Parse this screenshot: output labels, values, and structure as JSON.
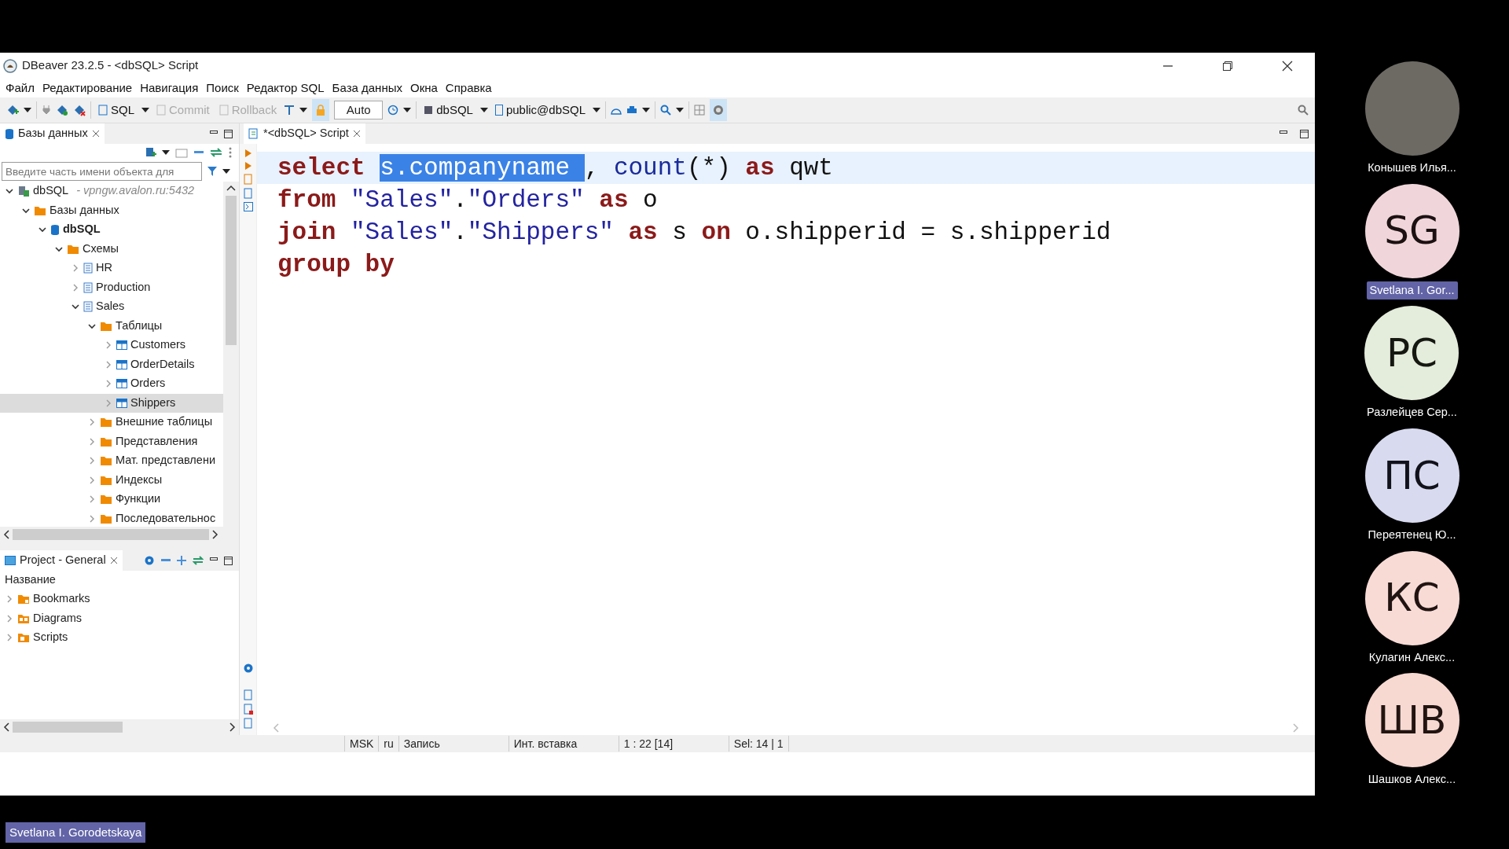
{
  "window": {
    "title": "DBeaver 23.2.5 - <dbSQL> Script"
  },
  "menu": [
    "Файл",
    "Редактирование",
    "Навигация",
    "Поиск",
    "Редактор SQL",
    "База данных",
    "Окна",
    "Справка"
  ],
  "toolbar": [
    {
      "label": "SQL",
      "disabled": false
    },
    {
      "label": "Commit",
      "disabled": true
    },
    {
      "label": "Rollback",
      "disabled": true
    },
    {
      "label": "Auto",
      "disabled": false
    },
    {
      "label": "dbSQL",
      "disabled": false
    },
    {
      "label": "public@dbSQL",
      "disabled": false
    }
  ],
  "navigator": {
    "tab": "Базы данных",
    "filter_placeholder": "Введите часть имени объекта для",
    "tree": [
      {
        "kind": "connection",
        "label": "dbSQL",
        "host": "- vpngw.avalon.ru:5432",
        "expanded": true,
        "selected": false,
        "children": [
          {
            "kind": "folder",
            "label": "Базы данных",
            "expanded": true,
            "selected": false,
            "children": [
              {
                "kind": "database",
                "label": "dbSQL",
                "expanded": true,
                "selected": false,
                "children": [
                  {
                    "kind": "folder",
                    "label": "Схемы",
                    "expanded": true,
                    "selected": false,
                    "children": [
                      {
                        "kind": "schema",
                        "label": "HR",
                        "expanded": false,
                        "selected": false
                      },
                      {
                        "kind": "schema",
                        "label": "Production",
                        "expanded": false,
                        "selected": false
                      },
                      {
                        "kind": "schema",
                        "label": "Sales",
                        "expanded": true,
                        "selected": false,
                        "children": [
                          {
                            "kind": "folder",
                            "label": "Таблицы",
                            "expanded": true,
                            "selected": false,
                            "children": [
                              {
                                "kind": "table",
                                "label": "Customers",
                                "expanded": false,
                                "selected": false
                              },
                              {
                                "kind": "table",
                                "label": "OrderDetails",
                                "expanded": false,
                                "selected": false
                              },
                              {
                                "kind": "table",
                                "label": "Orders",
                                "expanded": false,
                                "selected": false
                              },
                              {
                                "kind": "table",
                                "label": "Shippers",
                                "expanded": false,
                                "selected": true
                              }
                            ]
                          },
                          {
                            "kind": "folder",
                            "label": "Внешние таблицы",
                            "expanded": false,
                            "selected": false
                          },
                          {
                            "kind": "folder",
                            "label": "Представления",
                            "expanded": false,
                            "selected": false
                          },
                          {
                            "kind": "folder",
                            "label": "Мат. представлени",
                            "expanded": false,
                            "selected": false
                          },
                          {
                            "kind": "folder",
                            "label": "Индексы",
                            "expanded": false,
                            "selected": false
                          },
                          {
                            "kind": "folder",
                            "label": "Функции",
                            "expanded": false,
                            "selected": false
                          },
                          {
                            "kind": "folder",
                            "label": "Последовательнос",
                            "expanded": false,
                            "selected": false
                          }
                        ]
                      }
                    ]
                  }
                ]
              }
            ]
          }
        ]
      }
    ]
  },
  "project": {
    "tab": "Project - General",
    "column": "Название",
    "items": [
      {
        "label": "Bookmarks",
        "expanded": false
      },
      {
        "label": "Diagrams",
        "expanded": false
      },
      {
        "label": "Scripts",
        "expanded": false
      }
    ]
  },
  "editor": {
    "tab": "*<dbSQL> Script",
    "lines": [
      {
        "current": true,
        "tokens": [
          {
            "kind": "keyword",
            "text": "select ",
            "selected": false
          },
          {
            "kind": "plain",
            "text": "s.companyname ",
            "selected": true
          },
          {
            "kind": "plain",
            "text": ", ",
            "selected": false
          },
          {
            "kind": "function",
            "text": "count",
            "selected": false
          },
          {
            "kind": "plain",
            "text": "(*) ",
            "selected": false
          },
          {
            "kind": "keyword",
            "text": "as ",
            "selected": false
          },
          {
            "kind": "plain",
            "text": "qwt",
            "selected": false
          }
        ]
      },
      {
        "current": false,
        "tokens": [
          {
            "kind": "keyword",
            "text": "from ",
            "selected": false
          },
          {
            "kind": "string",
            "text": "\"Sales\"",
            "selected": false
          },
          {
            "kind": "plain",
            "text": ".",
            "selected": false
          },
          {
            "kind": "string",
            "text": "\"Orders\" ",
            "selected": false
          },
          {
            "kind": "keyword",
            "text": "as ",
            "selected": false
          },
          {
            "kind": "plain",
            "text": "o",
            "selected": false
          }
        ]
      },
      {
        "current": false,
        "tokens": [
          {
            "kind": "keyword",
            "text": "join ",
            "selected": false
          },
          {
            "kind": "string",
            "text": "\"Sales\"",
            "selected": false
          },
          {
            "kind": "plain",
            "text": ".",
            "selected": false
          },
          {
            "kind": "string",
            "text": "\"Shippers\" ",
            "selected": false
          },
          {
            "kind": "keyword",
            "text": "as ",
            "selected": false
          },
          {
            "kind": "plain",
            "text": "s ",
            "selected": false
          },
          {
            "kind": "keyword",
            "text": "on ",
            "selected": false
          },
          {
            "kind": "plain",
            "text": "o.shipperid = s.shipperid",
            "selected": false
          }
        ]
      },
      {
        "current": false,
        "tokens": [
          {
            "kind": "keyword",
            "text": "group by",
            "selected": false
          }
        ]
      }
    ]
  },
  "status_bar": [
    "MSK",
    "ru",
    "Запись",
    "Инт. вставка",
    "1 : 22 [14]",
    "Sel: 14 | 1"
  ],
  "participants": [
    {
      "kind": "photo",
      "name": "Конышев Илья...",
      "active": false
    },
    {
      "kind": "initials",
      "initials": "SG",
      "name": "Svetlana I. Gor...",
      "color": "#f0d6da",
      "active": true
    },
    {
      "kind": "initials",
      "initials": "PC",
      "name": "Разлейцев Сер...",
      "color": "#e4ecdb",
      "active": false
    },
    {
      "kind": "initials",
      "initials": "ПС",
      "name": "Переятенец Ю...",
      "color": "#d8daef",
      "active": false
    },
    {
      "kind": "initials",
      "initials": "КС",
      "name": "Кулагин Алекс...",
      "color": "#f9dbd6",
      "active": false
    },
    {
      "kind": "initials",
      "initials": "ШВ",
      "name": "Шашков Алекс...",
      "color": "#f7d9d1",
      "active": false
    }
  ],
  "presenter": "Svetlana I. Gorodetskaya"
}
